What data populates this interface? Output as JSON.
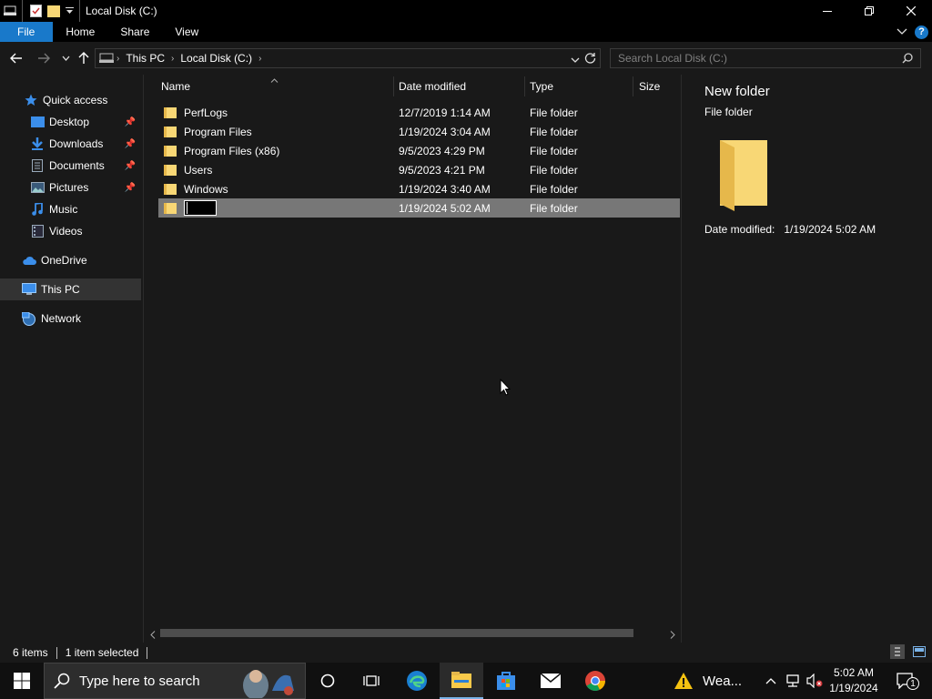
{
  "window": {
    "title": "Local Disk (C:)"
  },
  "ribbon": {
    "tabs": [
      "File",
      "Home",
      "Share",
      "View"
    ]
  },
  "address": {
    "crumbs": [
      "This PC",
      "Local Disk (C:)"
    ],
    "search_placeholder": "Search Local Disk (C:)"
  },
  "sidebar": {
    "items": [
      {
        "label": "Quick access",
        "icon": "star-icon",
        "pinned": false
      },
      {
        "label": "Desktop",
        "icon": "desktop-icon",
        "pinned": true
      },
      {
        "label": "Downloads",
        "icon": "download-icon",
        "pinned": true
      },
      {
        "label": "Documents",
        "icon": "document-icon",
        "pinned": true
      },
      {
        "label": "Pictures",
        "icon": "pictures-icon",
        "pinned": true
      },
      {
        "label": "Music",
        "icon": "music-icon",
        "pinned": false
      },
      {
        "label": "Videos",
        "icon": "videos-icon",
        "pinned": false
      },
      {
        "label": "OneDrive",
        "icon": "cloud-icon",
        "pinned": false
      },
      {
        "label": "This PC",
        "icon": "computer-icon",
        "pinned": false,
        "selected": true
      },
      {
        "label": "Network",
        "icon": "network-icon",
        "pinned": false
      }
    ]
  },
  "columns": {
    "name": "Name",
    "date": "Date modified",
    "type": "Type",
    "size": "Size"
  },
  "files": [
    {
      "name": "PerfLogs",
      "date": "12/7/2019 1:14 AM",
      "type": "File folder"
    },
    {
      "name": "Program Files",
      "date": "1/19/2024 3:04 AM",
      "type": "File folder"
    },
    {
      "name": "Program Files (x86)",
      "date": "9/5/2023 4:29 PM",
      "type": "File folder"
    },
    {
      "name": "Users",
      "date": "9/5/2023 4:21 PM",
      "type": "File folder"
    },
    {
      "name": "Windows",
      "date": "1/19/2024 3:40 AM",
      "type": "File folder"
    },
    {
      "name": "",
      "date": "1/19/2024 5:02 AM",
      "type": "File folder",
      "renaming": true,
      "selected": true
    }
  ],
  "preview": {
    "name": "New folder",
    "type": "File folder",
    "meta_label": "Date modified:",
    "meta_value": "1/19/2024 5:02 AM"
  },
  "status": {
    "count": "6 items",
    "selected": "1 item selected"
  },
  "taskbar": {
    "search_placeholder": "Type here to search",
    "weather_label": "Wea...",
    "time": "5:02 AM",
    "date": "1/19/2024",
    "notification_count": "1"
  },
  "colors": {
    "accent": "#1979ca",
    "folder": "#f8d775",
    "folder_dark": "#e6b84b",
    "selection": "#777777"
  }
}
